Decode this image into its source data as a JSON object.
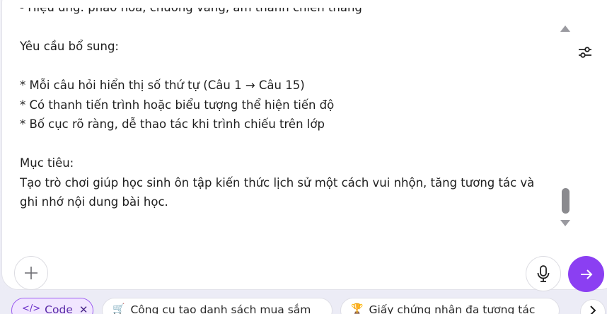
{
  "prompt_text": {
    "lines": [
      "- Hiệu ứng: pháo hoa, chuông vàng, âm thanh chiến thắng",
      "",
      "Yêu cầu bổ sung:",
      "",
      "* Mỗi câu hỏi hiển thị số thứ tự (Câu 1 → Câu 15)",
      "* Có thanh tiến trình hoặc biểu tượng thể hiện tiến độ",
      "* Bố cục rõ ràng, dễ thao tác khi trình chiếu trên lớp",
      "",
      "Mục tiêu:",
      "Tạo trò chơi giúp học sinh ôn tập kiến thức lịch sử một cách vui nhộn, tăng tương tác và",
      "ghi nhớ nội dung bài học."
    ]
  },
  "chips": {
    "code": {
      "icon": "code-icon",
      "label": "Code"
    },
    "shopping": {
      "icon": "cart-icon",
      "label": "Công cụ tạo danh sách mua sắm"
    },
    "certificate": {
      "icon": "trophy-icon",
      "label": "Giấy chứng nhận đa tương tác"
    }
  },
  "colors": {
    "send_button": "#8b3ff2",
    "code_chip_bg": "#f1e6ff",
    "code_chip_border": "#9b5cf0"
  }
}
